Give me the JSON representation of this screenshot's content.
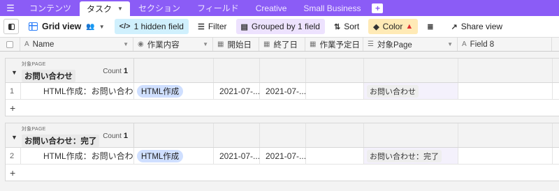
{
  "tabs": [
    "コンテンツ",
    "タスク",
    "セクション",
    "フィールド",
    "Creative",
    "Small Business"
  ],
  "view": {
    "name": "Grid view",
    "hidden_fields": "1 hidden field",
    "filter": "Filter",
    "grouped": "Grouped by 1 field",
    "sort": "Sort",
    "color": "Color",
    "share": "Share view"
  },
  "columns": [
    "Name",
    "作業内容",
    "開始日",
    "終了日",
    "作業予定日",
    "対象Page",
    "Field 8"
  ],
  "groups": [
    {
      "field_label": "対象PAGE",
      "value": "お問い合わせ",
      "count_label": "Count",
      "count": "1",
      "rows": [
        {
          "num": "1",
          "name": "HTML作成：お問い合わせ",
          "task": "HTML作成",
          "start": "2021-07-...",
          "end": "2021-07-...",
          "planned": "",
          "page": "お問い合わせ",
          "field8": ""
        }
      ]
    },
    {
      "field_label": "対象PAGE",
      "value": "お問い合わせ：完了",
      "count_label": "Count",
      "count": "1",
      "rows": [
        {
          "num": "2",
          "name": "HTML作成：お問い合わせ：...",
          "task": "HTML作成",
          "start": "2021-07-...",
          "end": "2021-07-...",
          "planned": "",
          "page": "お問い合わせ：完了",
          "field8": ""
        }
      ]
    }
  ],
  "add_row": "+",
  "colors": {
    "tabbar": "#8b5cf6",
    "hidden_btn": "#d0f0fd",
    "grouped_btn": "#ede2fe",
    "color_btn": "#ffeab6",
    "tag": "#cfdfff"
  }
}
